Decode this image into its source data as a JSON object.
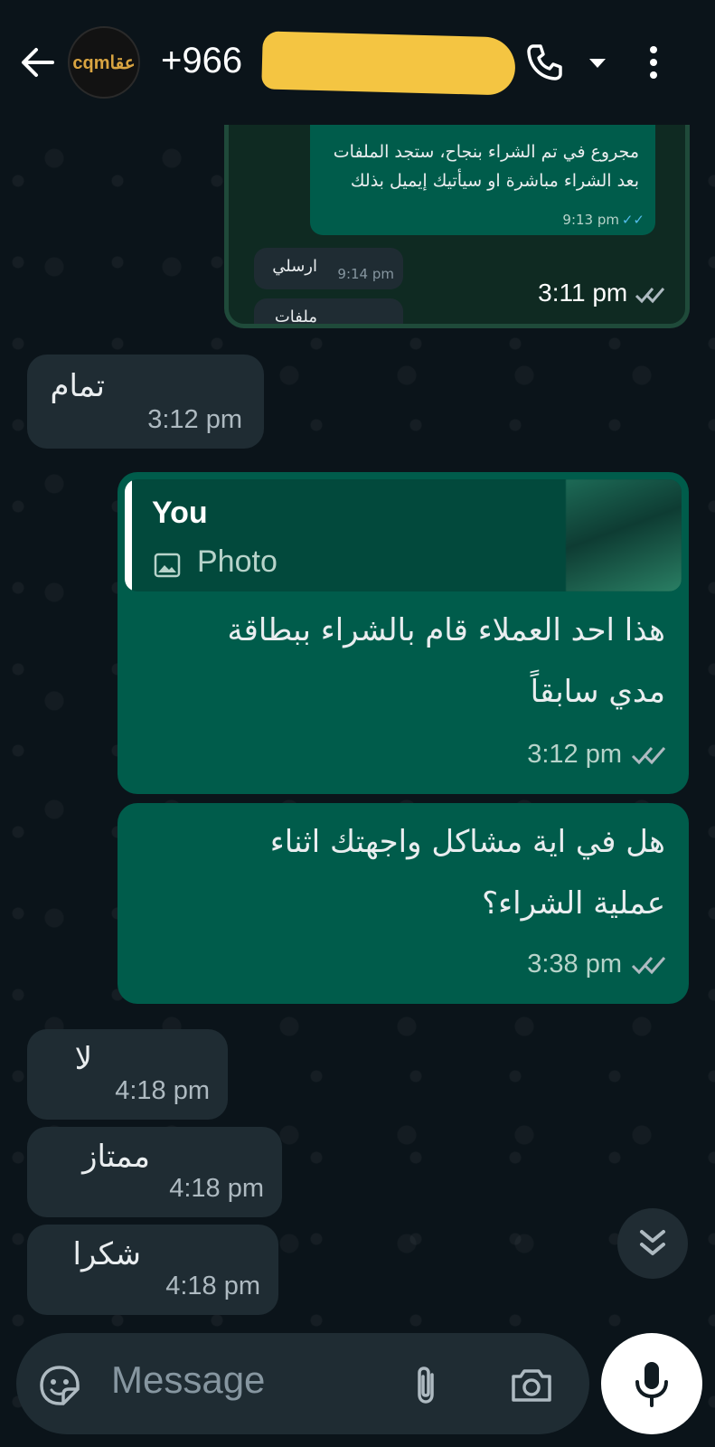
{
  "header": {
    "avatar_logo": "cqmعقا",
    "contact_name": "+966"
  },
  "forwarded_preview": {
    "out_message": "مجروع في تم الشراء بنجاح، ستجد الملفات بعد الشراء مباشرة او سيأتيك إيميل بذلك",
    "out_time": "9:13 pm",
    "in_message_1": "ارسلي",
    "in_time_1": "9:14 pm",
    "in_message_2": "ملفات",
    "time": "3:11 pm"
  },
  "messages": [
    {
      "text": "تمام",
      "time": "3:12 pm"
    },
    {
      "quote_author": "You",
      "quote_type": "Photo",
      "line1": "هذا احد العملاء قام بالشراء ببطاقة",
      "line2": "مدي سابقاً",
      "time": "3:12 pm"
    },
    {
      "line1": "هل في اية مشاكل واجهتك اثناء",
      "line2": "عملية الشراء؟",
      "time": "3:38 pm"
    },
    {
      "text": "لا",
      "time": "4:18 pm"
    },
    {
      "text": "ممتاز",
      "time": "4:18 pm"
    },
    {
      "text": "شكرا",
      "time": "4:18 pm"
    }
  ],
  "composer": {
    "placeholder": "Message"
  },
  "colors": {
    "incoming_bubble": "#1f2c33",
    "outgoing_bubble": "#005c4b",
    "read_tick": "#53bdeb",
    "redaction": "#f4c542"
  }
}
